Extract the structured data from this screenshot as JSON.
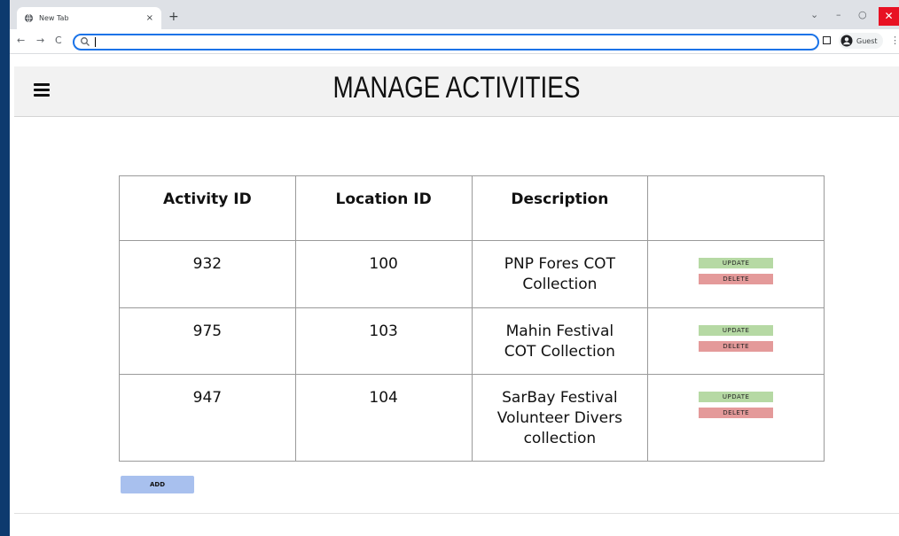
{
  "browser": {
    "tab_title": "New Tab",
    "tab_close": "×",
    "new_tab": "+",
    "controls": {
      "dropdown": "⌄",
      "minimize": "–",
      "restore": "○",
      "close": "✕"
    },
    "nav": {
      "back": "←",
      "forward": "→",
      "reload": "C"
    },
    "address_value": "",
    "profile_label": "Guest",
    "menu": "⋮"
  },
  "app": {
    "title": "MANAGE ACTIVITIES"
  },
  "table": {
    "headers": [
      "Activity ID",
      "Location ID",
      "Description",
      ""
    ],
    "rows": [
      {
        "activity_id": "932",
        "location_id": "100",
        "description": "PNP Fores COT Collection"
      },
      {
        "activity_id": "975",
        "location_id": "103",
        "description": "Mahin Festival COT Collection"
      },
      {
        "activity_id": "947",
        "location_id": "104",
        "description": "SarBay Festival Volunteer Divers collection"
      }
    ],
    "update_label": "UPDATE",
    "delete_label": "DELETE"
  },
  "add_label": "ADD",
  "colors": {
    "update": "#b6d9a4",
    "delete": "#e49a9a",
    "add": "#a8c0ee",
    "close": "#e81123"
  }
}
